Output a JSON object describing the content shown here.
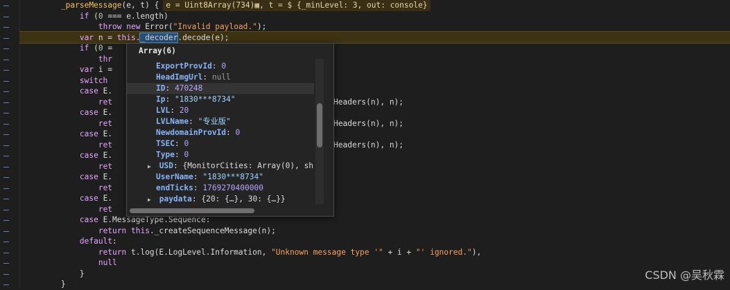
{
  "code_lines": [
    {
      "indent": 4,
      "parts": [
        [
          "fn",
          "_parseMessage"
        ],
        [
          "plain",
          "(e, t) {"
        ]
      ],
      "hint": "e = Uint8Array(734)▦, t = $ {_minLevel: 3, out: console}"
    },
    {
      "indent": 6,
      "parts": [
        [
          "kw",
          "if"
        ],
        [
          "plain",
          " ("
        ],
        [
          "num",
          "0"
        ],
        [
          "plain",
          " === e.length)"
        ]
      ]
    },
    {
      "indent": 8,
      "parts": [
        [
          "kw",
          "throw"
        ],
        [
          "plain",
          " "
        ],
        [
          "kw",
          "new"
        ],
        [
          "plain",
          " Error("
        ],
        [
          "str",
          "\"Invalid payload.\""
        ],
        [
          "plain",
          ");"
        ]
      ]
    },
    {
      "indent": 6,
      "parts": [
        [
          "kw",
          "var"
        ],
        [
          "plain",
          " n = "
        ],
        [
          "kw",
          "this"
        ],
        [
          "plain",
          "."
        ],
        [
          "sel",
          "_decoder"
        ],
        [
          "plain",
          ".decode(e);"
        ]
      ]
    },
    {
      "indent": 6,
      "parts": [
        [
          "kw",
          "if"
        ],
        [
          "plain",
          " ("
        ],
        [
          "num",
          "0"
        ],
        [
          "plain",
          " ="
        ]
      ]
    },
    {
      "indent": 8,
      "parts": [
        [
          "kw",
          "thr"
        ]
      ]
    },
    {
      "indent": 6,
      "parts": [
        [
          "kw",
          "var"
        ],
        [
          "plain",
          " i ="
        ]
      ]
    },
    {
      "indent": 6,
      "parts": [
        [
          "kw",
          "switch"
        ]
      ]
    },
    {
      "indent": 6,
      "parts": [
        [
          "kw",
          "case"
        ],
        [
          "plain",
          " E."
        ]
      ]
    },
    {
      "indent": 8,
      "parts": [
        [
          "kw",
          "ret"
        ]
      ],
      "tail": "Headers(n), n);"
    },
    {
      "indent": 6,
      "parts": [
        [
          "kw",
          "case"
        ],
        [
          "plain",
          " E."
        ]
      ]
    },
    {
      "indent": 8,
      "parts": [
        [
          "kw",
          "ret"
        ]
      ],
      "tail": "Headers(n), n);"
    },
    {
      "indent": 6,
      "parts": [
        [
          "kw",
          "case"
        ],
        [
          "plain",
          " E."
        ]
      ]
    },
    {
      "indent": 8,
      "parts": [
        [
          "kw",
          "ret"
        ]
      ],
      "tail": "Headers(n), n);"
    },
    {
      "indent": 6,
      "parts": [
        [
          "kw",
          "case"
        ],
        [
          "plain",
          " E."
        ]
      ]
    },
    {
      "indent": 8,
      "parts": [
        [
          "kw",
          "ret"
        ]
      ]
    },
    {
      "indent": 6,
      "parts": [
        [
          "kw",
          "case"
        ],
        [
          "plain",
          " E."
        ]
      ]
    },
    {
      "indent": 8,
      "parts": [
        [
          "kw",
          "ret"
        ]
      ]
    },
    {
      "indent": 6,
      "parts": [
        [
          "kw",
          "case"
        ],
        [
          "plain",
          " E."
        ]
      ]
    },
    {
      "indent": 8,
      "parts": [
        [
          "kw",
          "ret"
        ]
      ]
    },
    {
      "indent": 6,
      "parts": [
        [
          "kw",
          "case"
        ],
        [
          "plain",
          " E.MessageType.Sequence:"
        ]
      ]
    },
    {
      "indent": 8,
      "parts": [
        [
          "kw",
          "return"
        ],
        [
          "plain",
          " "
        ],
        [
          "kw",
          "this"
        ],
        [
          "plain",
          "._createSequenceMessage(n);"
        ]
      ]
    },
    {
      "indent": 6,
      "parts": [
        [
          "kw",
          "default"
        ],
        [
          "plain",
          ":"
        ]
      ]
    },
    {
      "indent": 8,
      "parts": [
        [
          "kw",
          "return"
        ],
        [
          "plain",
          " t.log(E.LogLevel.Information, "
        ],
        [
          "str",
          "\"Unknown message type '\""
        ],
        [
          "plain",
          " + i + "
        ],
        [
          "str",
          "\"' ignored.\""
        ],
        [
          "plain",
          "),"
        ]
      ]
    },
    {
      "indent": 8,
      "parts": [
        [
          "kw",
          "null"
        ]
      ]
    },
    {
      "indent": 6,
      "parts": [
        [
          "plain",
          "}"
        ]
      ]
    },
    {
      "indent": 4,
      "parts": [
        [
          "plain",
          "}"
        ]
      ]
    }
  ],
  "popup": {
    "title": "Array(6)",
    "rows": [
      {
        "key": "ExportProvId",
        "value": "0",
        "type": "num"
      },
      {
        "key": "HeadImgUrl",
        "value": "null",
        "type": "null"
      },
      {
        "key": "ID",
        "value": "470248",
        "type": "num",
        "selected": true
      },
      {
        "key": "Ip",
        "value": "\"1830***8734\"",
        "type": "str"
      },
      {
        "key": "LVL",
        "value": "20",
        "type": "num"
      },
      {
        "key": "LVLName",
        "value": "\"专业版\"",
        "type": "str"
      },
      {
        "key": "NewdomainProvId",
        "value": "0",
        "type": "num"
      },
      {
        "key": "TSEC",
        "value": "0",
        "type": "num"
      },
      {
        "key": "Type",
        "value": "0",
        "type": "num"
      },
      {
        "key": "USD",
        "value": "{MonitorCities: Array(0), sh",
        "type": "obj",
        "expandable": true
      },
      {
        "key": "UserName",
        "value": "\"1830***8734\"",
        "type": "str"
      },
      {
        "key": "endTicks",
        "value": "1769270400000",
        "type": "num"
      },
      {
        "key": "paydata",
        "value": "{20: {…}, 30: {…}}",
        "type": "obj",
        "expandable": true
      }
    ]
  },
  "watermark": "CSDN @吴秋霖"
}
